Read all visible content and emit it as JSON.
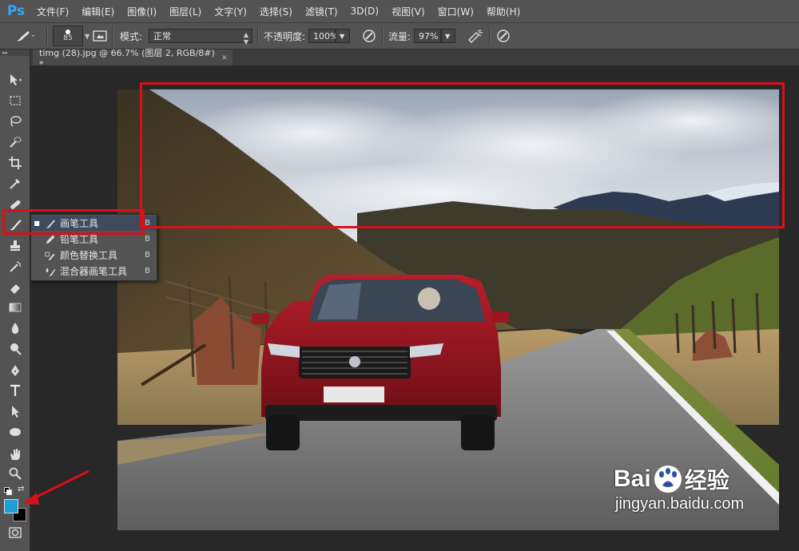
{
  "app": {
    "logo_text": "Ps"
  },
  "menu": [
    {
      "label": "文件(F)"
    },
    {
      "label": "编辑(E)"
    },
    {
      "label": "图像(I)"
    },
    {
      "label": "图层(L)"
    },
    {
      "label": "文字(Y)"
    },
    {
      "label": "选择(S)"
    },
    {
      "label": "滤镜(T)"
    },
    {
      "label": "3D(D)"
    },
    {
      "label": "视图(V)"
    },
    {
      "label": "窗口(W)"
    },
    {
      "label": "帮助(H)"
    }
  ],
  "options": {
    "brush_size": "85",
    "mode_label": "模式:",
    "mode_value": "正常",
    "opacity_label": "不透明度:",
    "opacity_value": "100%",
    "flow_label": "流量:",
    "flow_value": "97%"
  },
  "document": {
    "tab_title": "timg (28).jpg @ 66.7% (图层 2, RGB/8#) *",
    "close_glyph": "×"
  },
  "brush_flyout": {
    "items": [
      {
        "label": "画笔工具",
        "key": "B",
        "icon": "brush-icon",
        "selected": true
      },
      {
        "label": "铅笔工具",
        "key": "B",
        "icon": "pencil-icon",
        "selected": false
      },
      {
        "label": "颜色替换工具",
        "key": "B",
        "icon": "color-replace-icon",
        "selected": false
      },
      {
        "label": "混合器画笔工具",
        "key": "B",
        "icon": "mixer-brush-icon",
        "selected": false
      }
    ]
  },
  "colors": {
    "foreground": "#1e9fd8",
    "background": "#000000",
    "annotation": "#d8101a"
  },
  "watermark": {
    "brand_prefix": "Bai",
    "brand_suffix": "经验",
    "url": "jingyan.baidu.com"
  },
  "photo": {
    "license_plate_visible": false
  }
}
